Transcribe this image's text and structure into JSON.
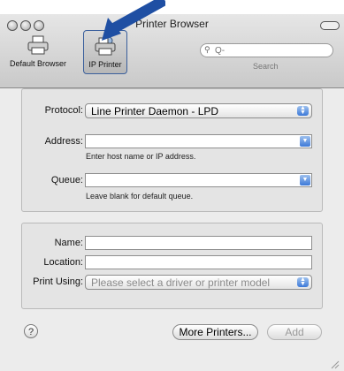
{
  "window": {
    "title": "Printer Browser"
  },
  "toolbar": {
    "default_browser_label": "Default Browser",
    "ip_printer_label": "IP Printer",
    "search_placeholder": "Q-",
    "search_label": "Search"
  },
  "connection": {
    "protocol_label": "Protocol:",
    "protocol_value": "Line Printer Daemon - LPD",
    "address_label": "Address:",
    "address_value": "",
    "address_hint": "Enter host name or IP address.",
    "queue_label": "Queue:",
    "queue_value": "",
    "queue_hint": "Leave blank for default queue."
  },
  "details": {
    "name_label": "Name:",
    "name_value": "",
    "location_label": "Location:",
    "location_value": "",
    "print_using_label": "Print Using:",
    "print_using_value": "Please select a driver or printer model"
  },
  "footer": {
    "help_label": "?",
    "more_printers_label": "More Printers...",
    "add_label": "Add"
  },
  "colors": {
    "accent": "#3d79d8",
    "arrow": "#1f4fa3"
  },
  "icons": {
    "default_browser": "printer-icon",
    "ip_printer": "network-printer-icon",
    "search": "search-icon",
    "pointer": "arrow-icon"
  }
}
